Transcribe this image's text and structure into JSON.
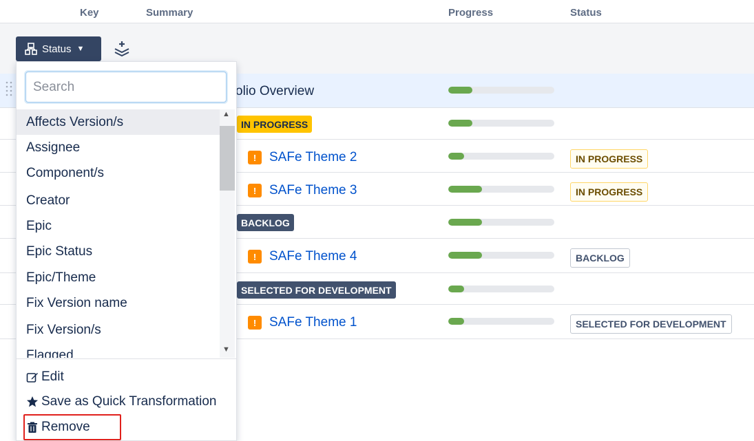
{
  "header": {
    "key": "Key",
    "summary": "Summary",
    "progress": "Progress",
    "status": "Status"
  },
  "toolbar": {
    "group_label": "Status",
    "group_icon": "hierarchy-icon",
    "layers_icon": "layers-add-icon"
  },
  "rows": [
    {
      "summary": "olio Overview",
      "progress": 0.23,
      "status": ""
    },
    {
      "lozenge": "IN PROGRESS",
      "progress": 0.23
    },
    {
      "summary": "SAFe Theme 2",
      "progress": 0.15,
      "status": "IN PROGRESS"
    },
    {
      "summary": "SAFe Theme 3",
      "progress": 0.32,
      "status": "IN PROGRESS"
    },
    {
      "lozenge": "BACKLOG",
      "progress": 0.32
    },
    {
      "summary": "SAFe Theme 4",
      "progress": 0.32,
      "status": "BACKLOG"
    },
    {
      "lozenge": "SELECTED FOR DEVELOPMENT",
      "progress": 0.15
    },
    {
      "summary": "SAFe Theme 1",
      "progress": 0.15,
      "status": "SELECTED FOR DEVELOPMENT"
    }
  ],
  "dropdown": {
    "search_placeholder": "Search",
    "options": [
      "Affects Version/s",
      "Assignee",
      "Component/s",
      "Creator",
      "Epic",
      "Epic Status",
      "Epic/Theme",
      "Fix Version name",
      "Fix Version/s",
      "Flagged"
    ],
    "actions": {
      "edit": "Edit",
      "save": "Save as Quick Transformation",
      "remove": "Remove"
    }
  },
  "colors": {
    "accent": "#0052cc",
    "progress_fill": "#6aa84f",
    "highlight": "#e0201c",
    "lozenge_yellow": "#ffc400",
    "lozenge_dark": "#42526e"
  }
}
